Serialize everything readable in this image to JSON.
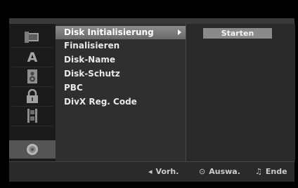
{
  "menu": {
    "items": [
      {
        "label": "Disk Initialisierung",
        "selected": true
      },
      {
        "label": "Finalisieren"
      },
      {
        "label": "Disk-Name"
      },
      {
        "label": "Disk-Schutz"
      },
      {
        "label": "PBC"
      },
      {
        "label": "DivX Reg. Code"
      }
    ]
  },
  "action": {
    "label": "Starten"
  },
  "sidebar": {
    "icons": [
      "display-icon",
      "language-icon",
      "speaker-icon",
      "lock-icon",
      "film-icon",
      "disc-icon"
    ],
    "selected": "disc-icon"
  },
  "footer": {
    "prev": {
      "glyph": "◂",
      "label": "Vorh."
    },
    "select": {
      "glyph": "⊙",
      "label": "Auswa."
    },
    "exit": {
      "glyph": "♫",
      "label": "Ende"
    }
  }
}
